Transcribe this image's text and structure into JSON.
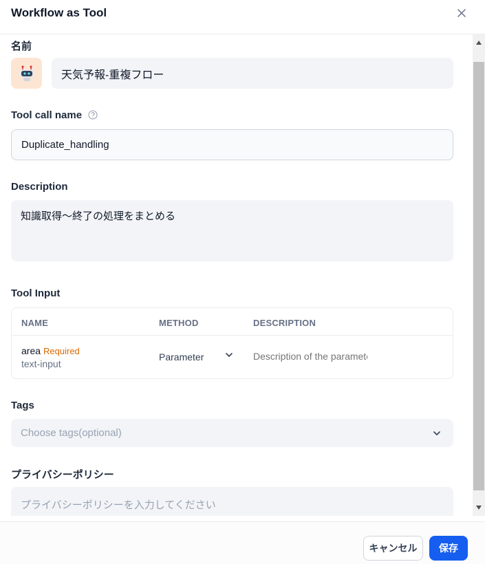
{
  "header": {
    "title": "Workflow as Tool"
  },
  "name_section": {
    "label": "名前",
    "value": "天気予報-重複フロー",
    "avatar_icon": "robot-icon"
  },
  "call_name": {
    "label": "Tool call name",
    "value": "Duplicate_handling"
  },
  "description": {
    "label": "Description",
    "value": "知識取得〜終了の処理をまとめる"
  },
  "tool_input": {
    "label": "Tool Input",
    "columns": [
      "NAME",
      "METHOD",
      "DESCRIPTION"
    ],
    "rows": [
      {
        "name": "area",
        "required": "Required",
        "type": "text-input",
        "method": "Parameter",
        "description_placeholder": "Description of the parameter"
      }
    ]
  },
  "tags": {
    "label": "Tags",
    "placeholder": "Choose tags(optional)"
  },
  "privacy": {
    "label": "プライバシーポリシー",
    "placeholder": "プライバシーポリシーを入力してください"
  },
  "footer": {
    "cancel_label": "キャンセル",
    "save_label": "保存"
  },
  "colors": {
    "accent": "#155eef",
    "required": "#dc6803",
    "avatar_bg": "#fde5d4"
  }
}
